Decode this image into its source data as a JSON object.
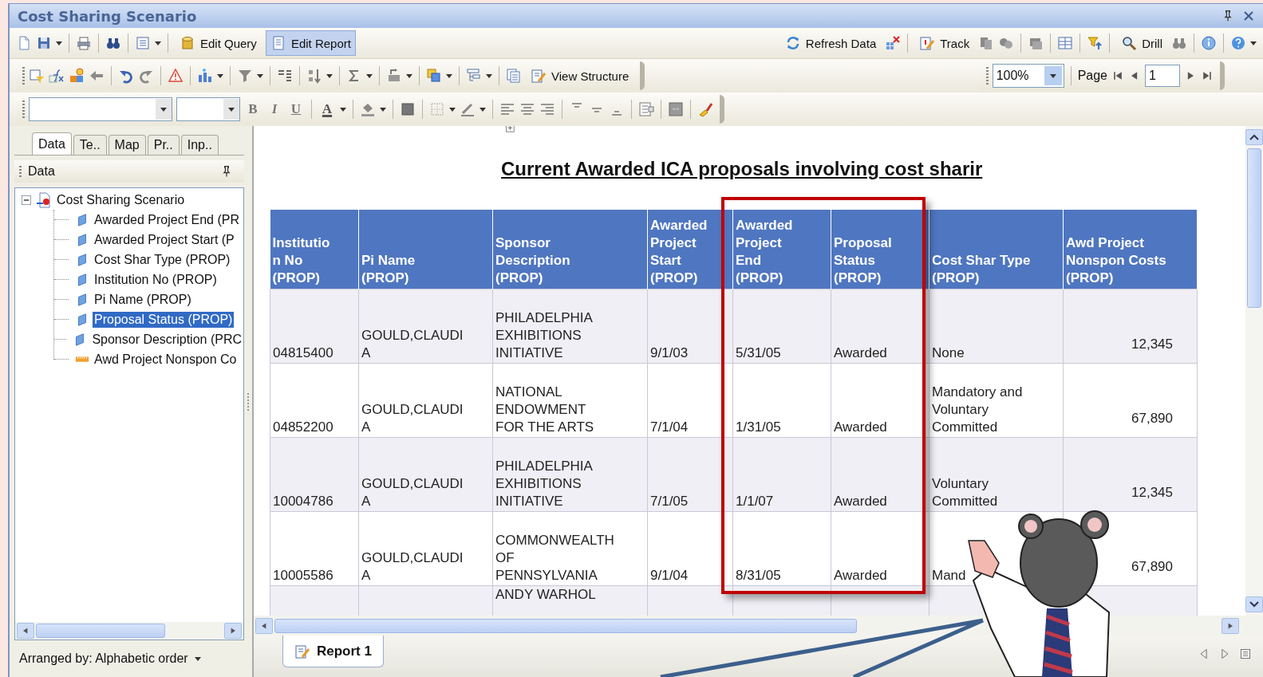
{
  "window": {
    "title": "Cost Sharing Scenario"
  },
  "toolbar": {
    "query_button": {
      "label": "Edit Query",
      "selected": false
    },
    "report_button": {
      "label": "Edit Report",
      "selected": true
    },
    "refresh_button": "Refresh Data",
    "track_button": "Track",
    "drill_button": "Drill"
  },
  "structure_toolbar": {
    "view_structure_button": "View Structure",
    "zoom": {
      "value": "100%"
    },
    "page_label": "Page",
    "page_field": {
      "value": "1"
    }
  },
  "format_toolbar": {
    "style_buttons": [
      "B",
      "I",
      "U"
    ],
    "font_color_glyph": "A"
  },
  "side_panel": {
    "tabs": [
      {
        "label": "Data",
        "selected": true
      },
      {
        "label": "Te..",
        "selected": false
      },
      {
        "label": "Map",
        "selected": false
      },
      {
        "label": "Pr..",
        "selected": false
      },
      {
        "label": "Inp..",
        "selected": false
      }
    ],
    "header": "Data",
    "tree": {
      "label": "Cost Sharing Scenario",
      "expanded": true,
      "children": [
        {
          "label": "Awarded Project End (PR",
          "kind": "dimension",
          "selected": false
        },
        {
          "label": "Awarded Project Start (P",
          "kind": "dimension",
          "selected": false
        },
        {
          "label": "Cost Shar Type (PROP)",
          "kind": "dimension",
          "selected": false
        },
        {
          "label": "Institution No (PROP)",
          "kind": "dimension",
          "selected": false
        },
        {
          "label": "Pi Name (PROP)",
          "kind": "dimension",
          "selected": false
        },
        {
          "label": "Proposal Status (PROP)",
          "kind": "dimension",
          "selected": true
        },
        {
          "label": "Sponsor Description (PRC",
          "kind": "dimension",
          "selected": false
        },
        {
          "label": "Awd Project Nonspon Co",
          "kind": "measure",
          "selected": false
        }
      ]
    },
    "footer": "Arranged by: Alphabetic order"
  },
  "report": {
    "title": "Current Awarded ICA proposals involving cost sharir",
    "tab": {
      "label": "Report 1",
      "selected": true
    },
    "table": {
      "columns": [
        "Institutio\nn No\n(PROP)",
        "Pi Name\n(PROP)",
        "Sponsor\nDescription\n(PROP)",
        "Awarded\nProject\nStart\n(PROP)",
        "Awarded\nProject\nEnd\n(PROP)",
        "Proposal\nStatus\n(PROP)",
        "Cost Shar Type\n(PROP)",
        "Awd Project\nNonspon Costs\n(PROP)"
      ],
      "rows": [
        {
          "institution_no": "04815400",
          "pi_name": "GOULD,CLAUDI\nA",
          "sponsor_description": "PHILADELPHIA\nEXHIBITIONS\nINITIATIVE",
          "awarded_project_start": "9/1/03",
          "awarded_project_end": "5/31/05",
          "proposal_status": "Awarded",
          "cost_shar_type": "None",
          "awd_project_nonspon_costs": "12,345"
        },
        {
          "institution_no": "04852200",
          "pi_name": "GOULD,CLAUDI\nA",
          "sponsor_description": "NATIONAL\nENDOWMENT\nFOR THE ARTS",
          "awarded_project_start": "7/1/04",
          "awarded_project_end": "1/31/05",
          "proposal_status": "Awarded",
          "cost_shar_type": "Mandatory and\nVoluntary\nCommitted",
          "awd_project_nonspon_costs": "67,890"
        },
        {
          "institution_no": "10004786",
          "pi_name": "GOULD,CLAUDI\nA",
          "sponsor_description": "PHILADELPHIA\nEXHIBITIONS\nINITIATIVE",
          "awarded_project_start": "7/1/05",
          "awarded_project_end": "1/1/07",
          "proposal_status": "Awarded",
          "cost_shar_type": "Voluntary\nCommitted",
          "awd_project_nonspon_costs": "12,345"
        },
        {
          "institution_no": "10005586",
          "pi_name": "GOULD,CLAUDI\nA",
          "sponsor_description": "COMMONWEALTH\nOF\nPENNSYLVANIA",
          "awarded_project_start": "9/1/04",
          "awarded_project_end": "8/31/05",
          "proposal_status": "Awarded",
          "cost_shar_type": "Mand",
          "awd_project_nonspon_costs": "67,890"
        },
        {
          "sponsor_description": "ANDY WARHOL"
        }
      ]
    }
  }
}
